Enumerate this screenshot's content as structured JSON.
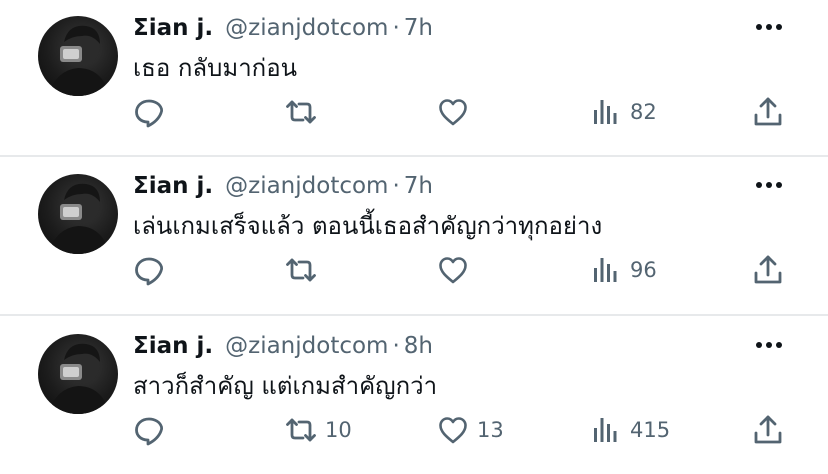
{
  "tweets": [
    {
      "name": "Σian j.",
      "handle": "@zianjdotcom",
      "separator": "·",
      "time": "7h",
      "text": "เธอ กลับมาก่อน",
      "replies": "",
      "retweets": "",
      "likes": "",
      "views": "82"
    },
    {
      "name": "Σian j.",
      "handle": "@zianjdotcom",
      "separator": "·",
      "time": "7h",
      "text": "เล่นเกมเสร็จแล้ว ตอนนี้เธอสำคัญกว่าทุกอย่าง",
      "replies": "",
      "retweets": "",
      "likes": "",
      "views": "96"
    },
    {
      "name": "Σian j.",
      "handle": "@zianjdotcom",
      "separator": "·",
      "time": "8h",
      "text": "สาวก็สำคัญ แต่เกมสำคัญกว่า",
      "replies": "",
      "retweets": "10",
      "likes": "13",
      "views": "415"
    }
  ],
  "colors": {
    "text_primary": "#0f1419",
    "text_secondary": "#536471",
    "divider": "#e7e9eb",
    "background": "#ffffff"
  },
  "icons": {
    "more": "more-horizontal-icon",
    "reply": "reply-bubble-icon",
    "retweet": "retweet-arrows-icon",
    "like": "heart-outline-icon",
    "views": "bar-chart-icon",
    "share": "share-upload-icon"
  }
}
